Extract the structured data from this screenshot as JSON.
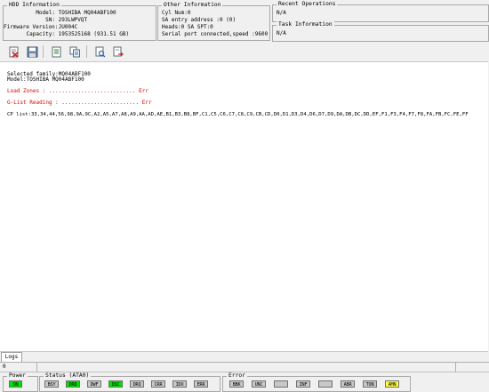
{
  "hdd": {
    "title": "HDD Information",
    "model_label": "Model:",
    "model": "TOSHIBA MQ04ABF100",
    "sn_label": "SN:",
    "sn": "293LWPVQT",
    "fw_label": "Firmware Version:",
    "fw": "JU004C",
    "cap_label": "Capacity:",
    "cap": "1953525168 (931.51 GB)"
  },
  "other": {
    "title": "Other Information",
    "lines": [
      "Cyl Num:0",
      "SA entry address :0 (0)",
      "Heads:0 SA SPT:0",
      "Serial port connected,speed :9600"
    ]
  },
  "recent": {
    "title": "Recent Operations",
    "value": "N/A"
  },
  "task": {
    "title": "Task Information",
    "value": "N/A"
  },
  "log": {
    "line1": "Selected family:MQ04ABF100",
    "line2": "Model:TOSHIBA MQ04ABF100",
    "line3": "Load Zones : ........................... Err",
    "line4": "G-List Reading : ........................ Err",
    "line5": "CP list:33,34,44,56,98,9A,9C,A2,A5,A7,A8,A9,AA,AD,AE,B1,B3,B8,BF,C1,C5,C6,C7,C8,C9,CB,CD,D0,D1,D3,D4,D6,D7,D9,DA,DB,DC,DD,EF,F1,F3,F4,F7,F8,FA,FB,FC,FE,FF"
  },
  "tab": "Logs",
  "statusbar": {
    "cell1": "0"
  },
  "power": {
    "title": "Power",
    "led": "ON",
    "color": "#00e000"
  },
  "status": {
    "title": "Status (ATA0)",
    "leds": [
      {
        "label": "BSY",
        "color": "#c8c8c8"
      },
      {
        "label": "DRD",
        "color": "#00e000"
      },
      {
        "label": "DWF",
        "color": "#c8c8c8"
      },
      {
        "label": "DSC",
        "color": "#00e000"
      },
      {
        "label": "DRQ",
        "color": "#c8c8c8"
      },
      {
        "label": "CRR",
        "color": "#c8c8c8"
      },
      {
        "label": "IDX",
        "color": "#c8c8c8"
      },
      {
        "label": "ERR",
        "color": "#c8c8c8"
      }
    ]
  },
  "error": {
    "title": "Error",
    "leds": [
      {
        "label": "BBK",
        "color": "#c8c8c8"
      },
      {
        "label": "UNC",
        "color": "#c8c8c8"
      },
      {
        "label": "",
        "color": "#c8c8c8"
      },
      {
        "label": "INF",
        "color": "#c8c8c8"
      },
      {
        "label": "",
        "color": "#c8c8c8"
      },
      {
        "label": "ABR",
        "color": "#c8c8c8"
      },
      {
        "label": "TON",
        "color": "#c8c8c8"
      },
      {
        "label": "AMN",
        "color": "#ffff40"
      }
    ]
  }
}
